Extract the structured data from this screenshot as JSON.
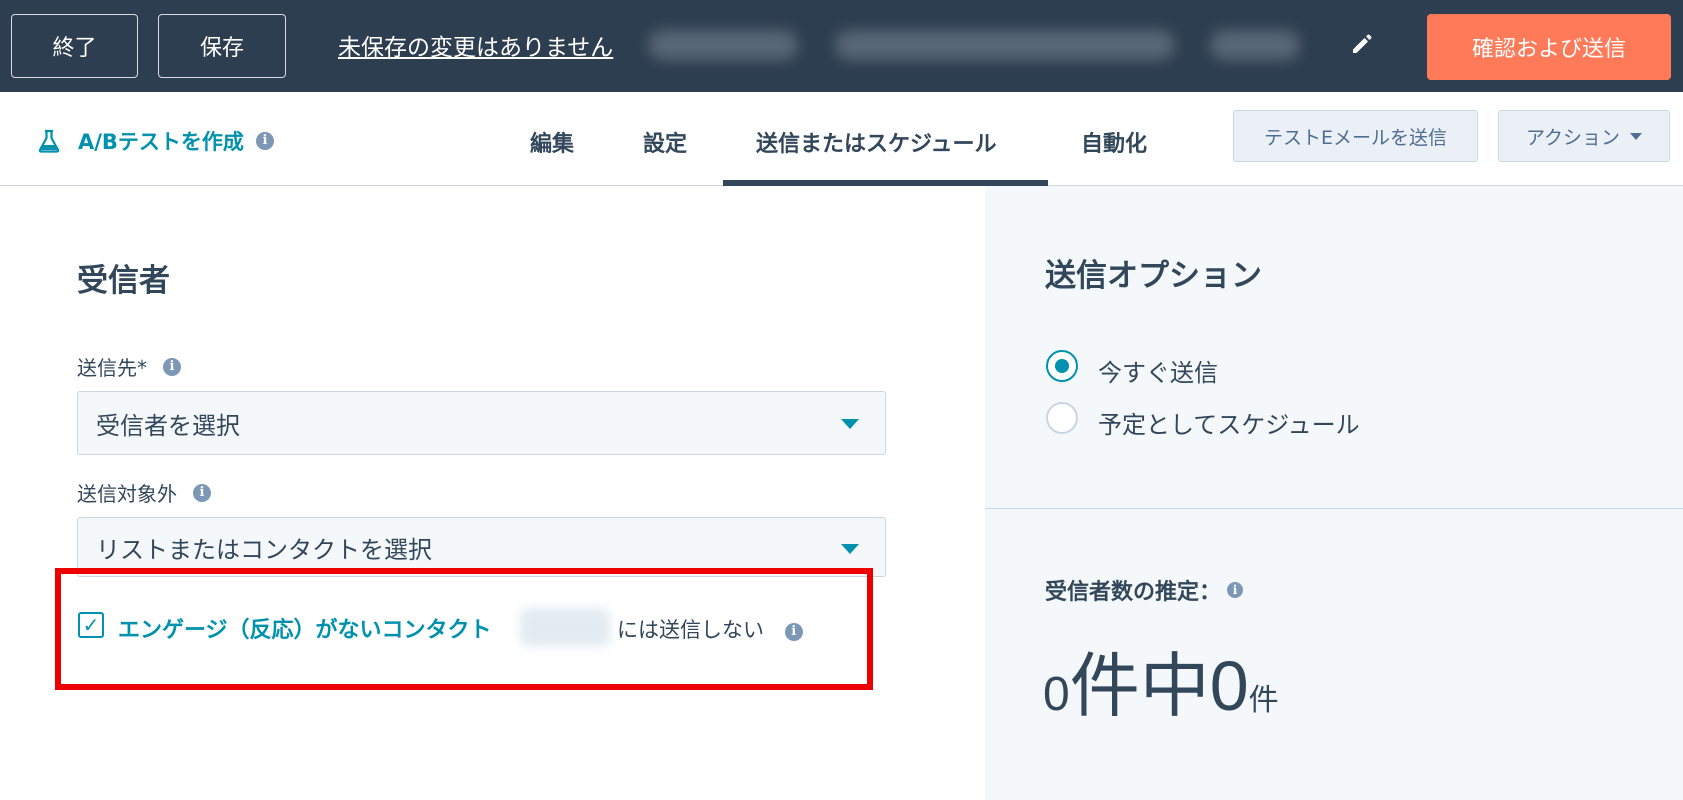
{
  "topbar": {
    "exit_label": "終了",
    "save_label": "保存",
    "unsaved_text": "未保存の変更はありません",
    "review_send_label": "確認および送信"
  },
  "subnav": {
    "ab_test_label": "A/Bテストを作成",
    "tabs": [
      {
        "label": "編集"
      },
      {
        "label": "設定"
      },
      {
        "label": "送信またはスケジュール"
      },
      {
        "label": "自動化"
      }
    ],
    "active_tab": "送信またはスケジュール",
    "test_email_label": "テストEメールを送信",
    "actions_label": "アクション"
  },
  "recipients": {
    "heading": "受信者",
    "send_to_label": "送信先*",
    "send_to_placeholder": "受信者を選択",
    "exclude_label": "送信対象外",
    "exclude_placeholder": "リストまたはコンタクトを選択",
    "unengaged_label": "エンゲージ（反応）がないコンタクト",
    "unengaged_suffix": "には送信しない",
    "unengaged_checked": true
  },
  "send_options": {
    "heading": "送信オプション",
    "options": [
      {
        "label": "今すぐ送信",
        "selected": true
      },
      {
        "label": "予定としてスケジュール",
        "selected": false
      }
    ]
  },
  "estimate": {
    "label": "受信者数の推定：",
    "num_a": "0",
    "unit_a": "件中",
    "num_b": "0",
    "unit_b": "件"
  },
  "colors": {
    "topbar_bg": "#2d3e50",
    "accent": "#0091ae",
    "primary_button": "#ff7a59",
    "highlight_box": "#ee0000"
  }
}
